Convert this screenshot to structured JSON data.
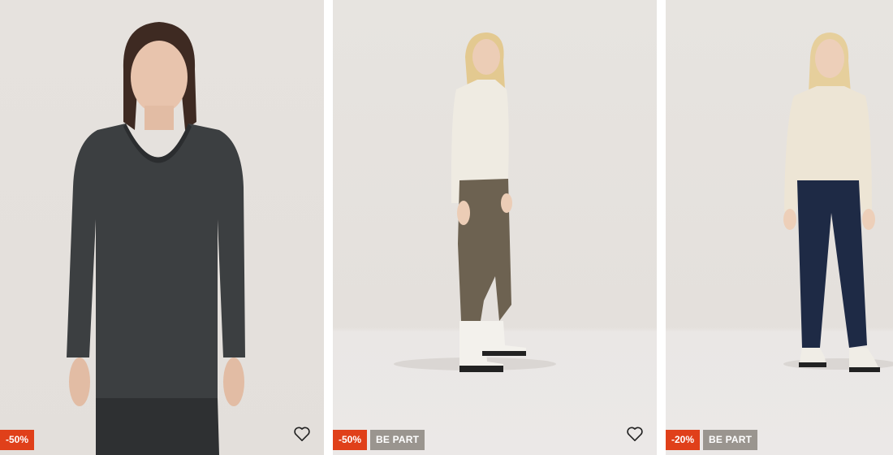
{
  "products": [
    {
      "discount": "-50%",
      "member_badge": ""
    },
    {
      "discount": "-50%",
      "member_badge": "BE PART"
    },
    {
      "discount": "-20%",
      "member_badge": "BE PART"
    }
  ],
  "colors": {
    "sale_badge": "#e0401a",
    "member_badge": "#9a958f",
    "background": "#e6e2de"
  },
  "icons": {
    "favorite": "heart-outline-icon"
  }
}
